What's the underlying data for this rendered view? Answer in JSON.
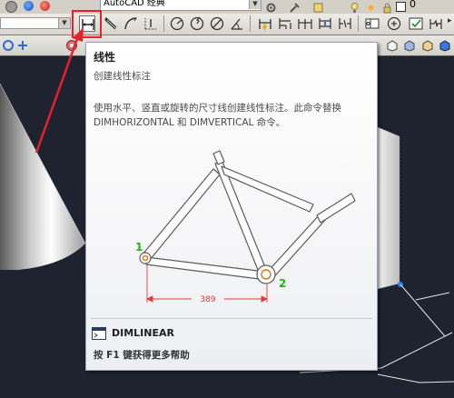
{
  "topbar": {
    "app_title": "AutoCAD 经典",
    "counter": "0"
  },
  "toolbar2": {
    "dropdown_value": ""
  },
  "tooltip": {
    "title": "线性",
    "subtitle": "创建线性标注",
    "description": "使用水平、竖直或旋转的尺寸线创建线性标注。此命令替换 DIMHORIZONTAL 和 DIMVERTICAL 命令。",
    "illustration": {
      "point1_label": "1",
      "point2_label": "2",
      "dimension_value": "389"
    },
    "command": "DIMLINEAR",
    "help_text": "按 F1 键获得更多帮助"
  },
  "colors": {
    "highlight": "#e8202a",
    "point_label": "#22b21d",
    "dimension_line": "#e23a3a",
    "viewport_bg": "#1f2330"
  },
  "icons": [
    "linear-dimension-icon",
    "aligned-dimension-icon",
    "arc-length-icon",
    "ordinate-icon",
    "radius-icon",
    "jogged-icon",
    "diameter-icon",
    "angular-icon",
    "quick-dimension-icon",
    "baseline-icon",
    "continue-icon",
    "dimension-space-icon",
    "dimension-break-icon",
    "tolerance-icon",
    "center-mark-icon",
    "inspection-icon",
    "jogged-linear-icon"
  ]
}
